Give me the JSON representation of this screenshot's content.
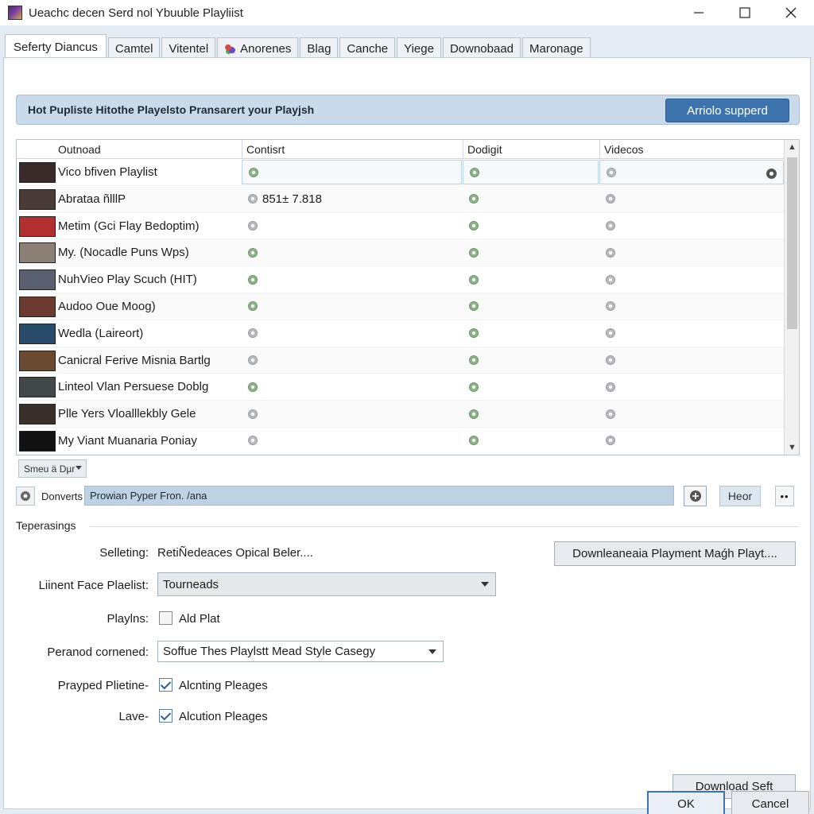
{
  "window": {
    "title": "Ueachc decen Serd nol Ybuuble Playliist"
  },
  "tabs": [
    {
      "label": "Seferty Diancus",
      "active": true
    },
    {
      "label": "Camtel"
    },
    {
      "label": "Vitentel"
    },
    {
      "label": "Anorenes",
      "icon": "grapes-icon"
    },
    {
      "label": "Blag"
    },
    {
      "label": "Canche"
    },
    {
      "label": "Yiege"
    },
    {
      "label": "Downobaad"
    },
    {
      "label": "Maronage"
    }
  ],
  "banner": {
    "text": "Hot Pupliste Hitothe Playelsto Pransarert your Playjsh",
    "button": "Arriolo supperd"
  },
  "table": {
    "columns": [
      "Outnoad",
      "Contisrt",
      "Dodigit",
      "Videcos"
    ],
    "rows": [
      {
        "name": "Vico bfiven Playlist",
        "c2": "",
        "c2_dot": "green",
        "c3_dot": "green",
        "c4_dot": "gray",
        "selected": true,
        "thumb": "#3a2a2a"
      },
      {
        "name": "Abratаa ñlllP",
        "c2": "851± 7.818",
        "c2_dot": "gray",
        "c3_dot": "green",
        "c4_dot": "gray",
        "thumb": "#4a3b36"
      },
      {
        "name": "Metim (Gci Flay Bedoptim)",
        "c2": "",
        "c2_dot": "gray",
        "c3_dot": "green",
        "c4_dot": "gray",
        "thumb": "#b23030"
      },
      {
        "name": "My. (Nocadle Puns Wps)",
        "c2": "",
        "c2_dot": "green",
        "c3_dot": "green",
        "c4_dot": "gray",
        "thumb": "#8a8076"
      },
      {
        "name": "NuhVieo Play Scuch (HIT)",
        "c2": "",
        "c2_dot": "green",
        "c3_dot": "green",
        "c4_dot": "gray",
        "thumb": "#5a6070"
      },
      {
        "name": "Audoo Oue Moog)",
        "c2": "",
        "c2_dot": "green",
        "c3_dot": "green",
        "c4_dot": "gray",
        "thumb": "#6b3a30"
      },
      {
        "name": "Wedla (Laireort)",
        "c2": "",
        "c2_dot": "gray",
        "c3_dot": "green",
        "c4_dot": "gray",
        "thumb": "#2a4a6a"
      },
      {
        "name": "Canicral Ferive Misnia Bartlg",
        "c2": "",
        "c2_dot": "gray",
        "c3_dot": "green",
        "c4_dot": "gray",
        "thumb": "#6a4a30"
      },
      {
        "name": "Linteol Vlan Persuese Doblg",
        "c2": "",
        "c2_dot": "green",
        "c3_dot": "green",
        "c4_dot": "gray",
        "thumb": "#40484a"
      },
      {
        "name": "Plle Yers Vloalllekbly Gele",
        "c2": "",
        "c2_dot": "gray",
        "c3_dot": "green",
        "c4_dot": "gray",
        "thumb": "#3a302a"
      },
      {
        "name": "My Viant Muanaria Poniay",
        "c2": "",
        "c2_dot": "gray",
        "c3_dot": "green",
        "c4_dot": "gray",
        "thumb": "#111111"
      }
    ]
  },
  "small_dropdown": "Smeu ä Dµr",
  "convert": {
    "label": "Donverts",
    "value": "Prowian Pyper Fron. /ana",
    "hear_button": "Heor",
    "more_button": "••"
  },
  "section": {
    "title": "Teperasings"
  },
  "form": {
    "selecting_label": "Selleting:",
    "selecting_value": "RetiÑedeaces Opical Beler....",
    "download_button": "Downleaneaia Playment Maǵh Playt....",
    "linient_label": "Liinent Face Plaelist:",
    "linient_value": "Tourneads",
    "playlins_label": "Playlns:",
    "playlins_value": "Ald Plat",
    "peranod_label": "Peranod cornened:",
    "peranod_value": "Soffue Thes Playlstt Mead Style Casegy",
    "prayped_label": "Prayped Plietine-",
    "prayped_value": "Alcnting Pleages",
    "prayped_checked": true,
    "lave_label": "Lave-",
    "lave_value": "Alcution Pleages",
    "lave_checked": true
  },
  "footer": {
    "download_self": "Download Seft",
    "ok": "OK",
    "cancel": "Cancel"
  }
}
